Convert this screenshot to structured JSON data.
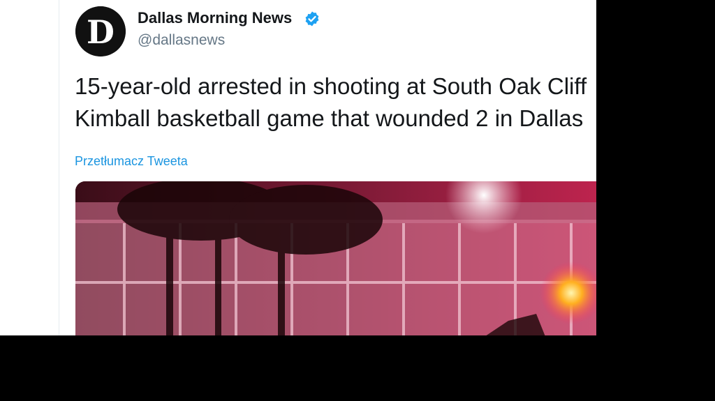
{
  "tweet": {
    "display_name": "Dallas Morning News",
    "handle": "@dallasnews",
    "verified": true,
    "text_lines": [
      "15-year-old arrested in shooting at South Oak Cliff",
      "Kimball basketball game that wounded 2 in Dallas"
    ],
    "translate_label": "Przetłumacz Tweeta",
    "avatar_letter": "D",
    "media_description": "photo-night-school-building"
  },
  "colors": {
    "name": "#14171a",
    "secondary": "#657786",
    "link": "#1b95e0",
    "verified": "#1da1f2",
    "background": "#ffffff",
    "letterbox": "#000000"
  },
  "icons": [
    "verified-badge-icon",
    "avatar-logo-icon"
  ]
}
